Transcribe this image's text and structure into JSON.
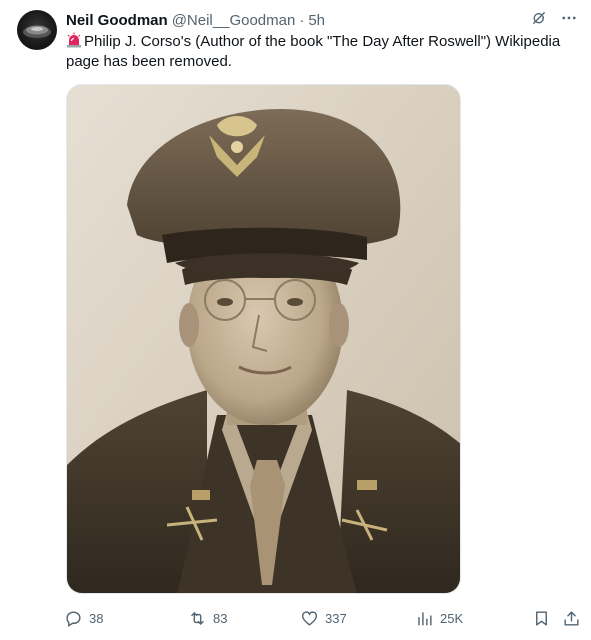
{
  "author": {
    "name": "Neil Goodman",
    "handle": "@Neil__Goodman",
    "separator": "·",
    "time": "5h"
  },
  "tweet": {
    "emoji_icon": "siren-emoji-icon",
    "text": "Philip J. Corso's (Author of the book \"The Day After Roswell\") Wikipedia page has been removed."
  },
  "media": {
    "icon": "portrait-photo"
  },
  "stats": {
    "replies": "38",
    "reposts": "83",
    "likes": "337",
    "views": "25K"
  },
  "colors": {
    "text": "#0f1419",
    "muted": "#536471",
    "siren": "#e0245e"
  }
}
